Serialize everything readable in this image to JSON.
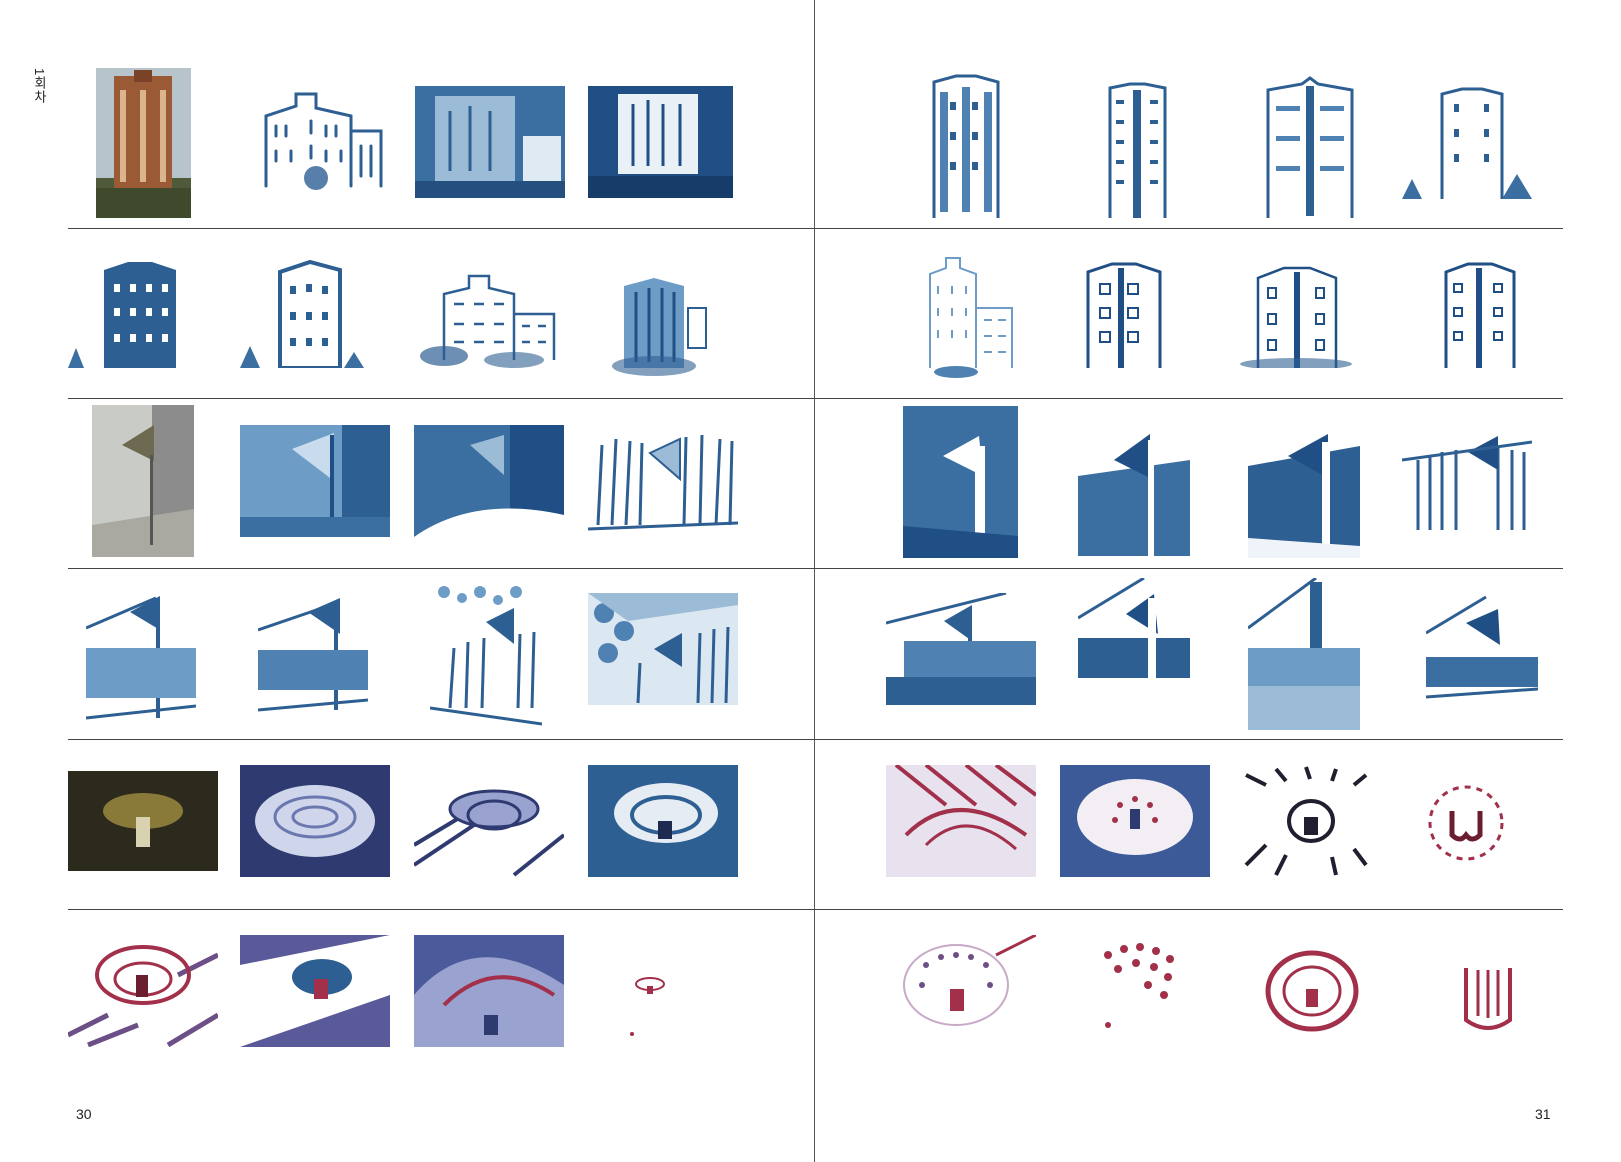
{
  "side_label": "1회차",
  "page_numbers": {
    "left": "30",
    "right": "31"
  },
  "colors": {
    "ink_blue": "#2e5f93",
    "ink_light": "#9cbbd6",
    "ink_red": "#a2304a",
    "ink_purple": "#6b4f86",
    "photo_brick": "#9a5a36",
    "photo_grey": "#8c8c8c",
    "photo_dark": "#2c2a1c"
  },
  "rows": [
    {
      "theme": "tower-building"
    },
    {
      "theme": "tower-building"
    },
    {
      "theme": "wall-with-triangle-sign"
    },
    {
      "theme": "wall-with-triangle-sign"
    },
    {
      "theme": "chandelier"
    },
    {
      "theme": "chandelier"
    }
  ]
}
